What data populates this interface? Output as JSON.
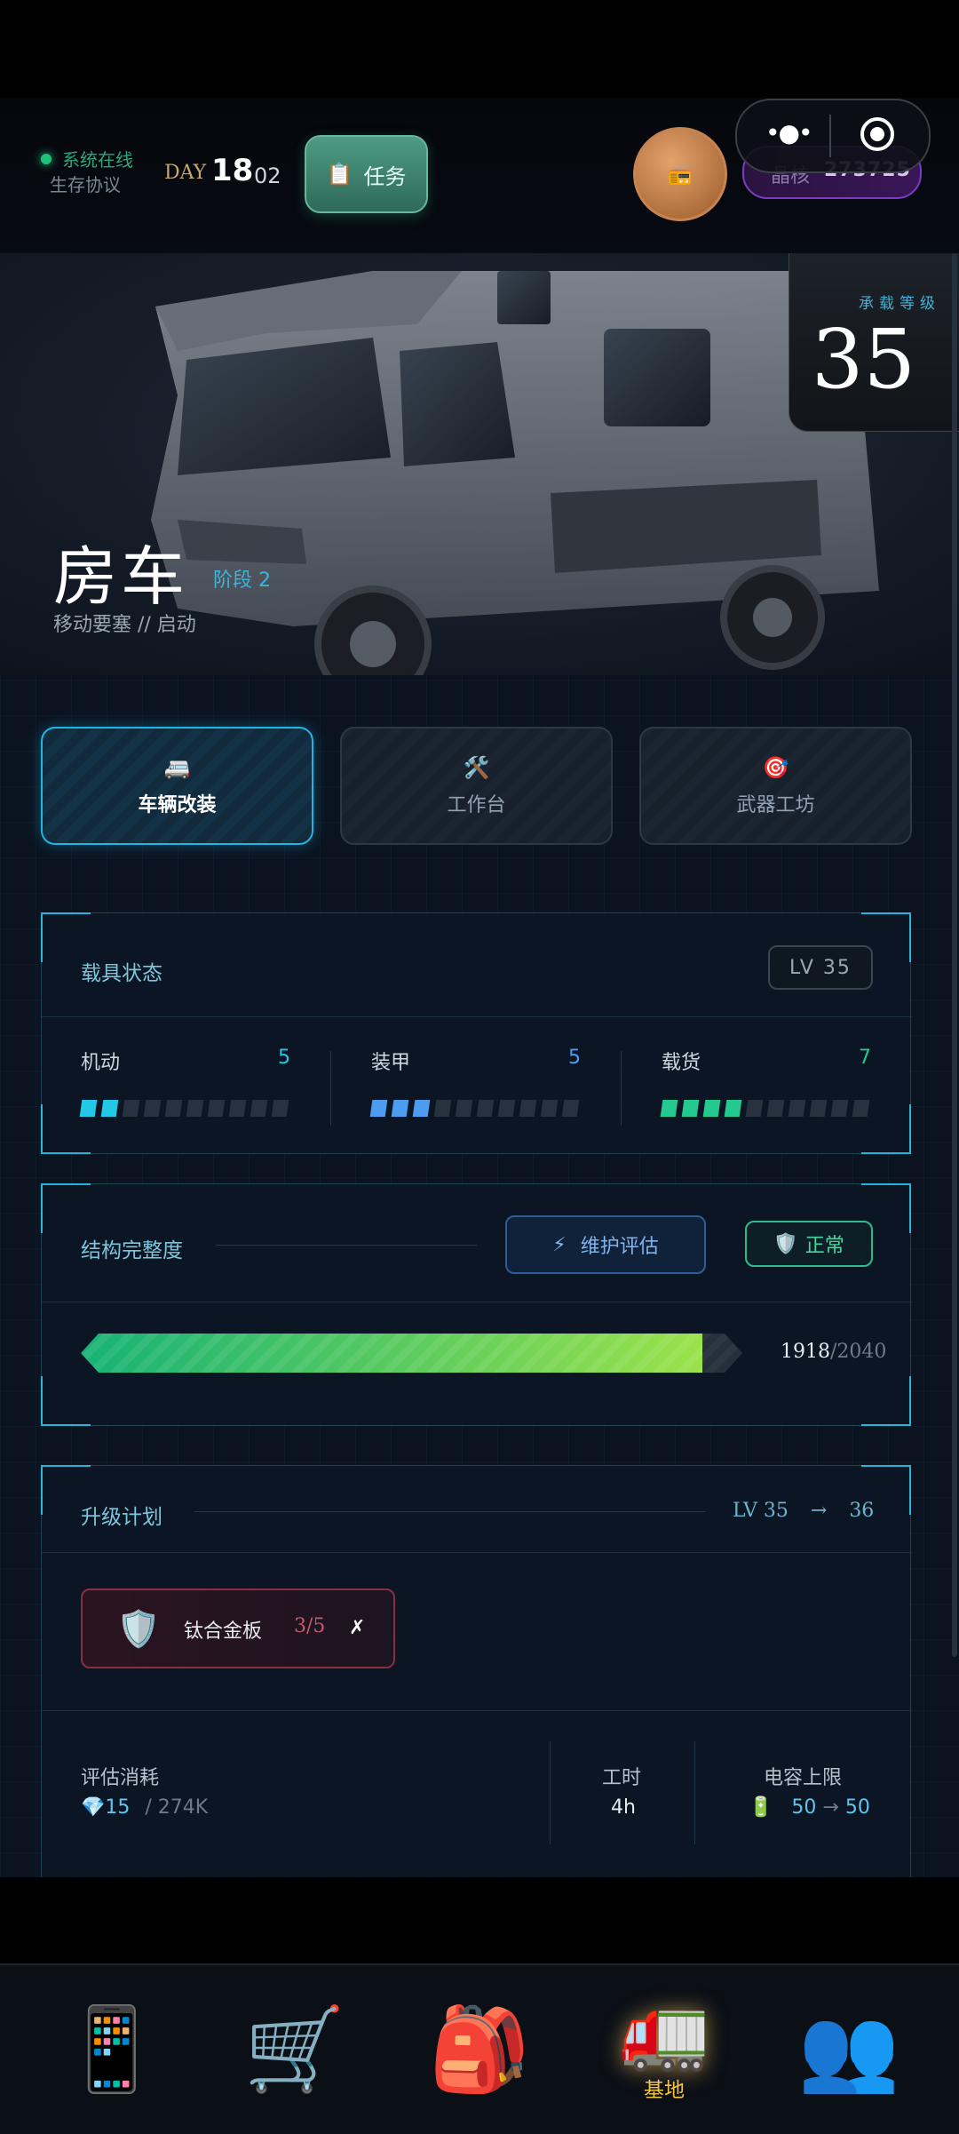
{
  "header": {
    "status_text": "系统在线",
    "protocol_text": "生存协议",
    "day_label": "DAY",
    "day_number": "18",
    "day_sub": "02",
    "task_icon": "📋",
    "task_label": "任务",
    "avatar_icon": "📻",
    "crystal_label": "晶核",
    "crystal_value": "273725"
  },
  "hero": {
    "level_label": "承载等级",
    "level_value": "35",
    "vehicle_name": "房车",
    "stage": "阶段 2",
    "subtitle": "移动要塞 // 启动"
  },
  "tabs": [
    {
      "icon": "🚐",
      "label": "车辆改装",
      "active": true
    },
    {
      "icon": "🛠️",
      "label": "工作台",
      "active": false
    },
    {
      "icon": "🎯",
      "label": "武器工坊",
      "active": false
    }
  ],
  "vehicle_status": {
    "title": "载具状态",
    "level_badge": "LV 35",
    "stats": [
      {
        "name": "机动",
        "value": "5",
        "filled": 2,
        "total": 10,
        "color": "#22c9e6"
      },
      {
        "name": "装甲",
        "value": "5",
        "filled": 3,
        "total": 10,
        "color": "#4c9cf0"
      },
      {
        "name": "载货",
        "value": "7",
        "filled": 4,
        "total": 10,
        "color": "#23c98e"
      }
    ]
  },
  "integrity": {
    "title": "结构完整度",
    "maintain_icon": "⚡",
    "maintain_label": "维护评估",
    "status_icon": "🛡️",
    "status_label": "正常",
    "current": "1918",
    "max": "/2040",
    "fraction": 0.94
  },
  "upgrade": {
    "title": "升级计划",
    "from": "LV 35",
    "arrow": "→",
    "to": "36",
    "material": {
      "icon": "🛡️",
      "name": "钛合金板",
      "count": "3/5",
      "status": "✗"
    },
    "cost_label": "评估消耗",
    "cost_value": "💎15",
    "cost_total": "/ 274K",
    "time_label": "工时",
    "time_value": "4h",
    "cap_label": "电容上限",
    "cap_icon": "🔋",
    "cap_from": "50",
    "cap_arrow": "→",
    "cap_to": "50"
  },
  "nav": [
    {
      "icon": "📱",
      "label": "",
      "active": false
    },
    {
      "icon": "🛒",
      "label": "",
      "active": false
    },
    {
      "icon": "🎒",
      "label": "",
      "active": false
    },
    {
      "icon": "🚛",
      "label": "基地",
      "active": true
    },
    {
      "icon": "👥",
      "label": "",
      "active": false
    }
  ],
  "colors": {
    "accent": "#22b6d8",
    "health_start": "#16b276",
    "health_end": "#9be24a",
    "warning": "#c45b6c",
    "nav_active": "#f3c34b"
  }
}
